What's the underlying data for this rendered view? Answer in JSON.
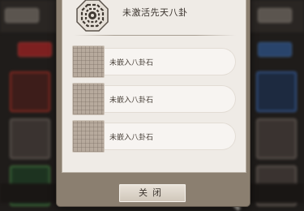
{
  "dialog": {
    "title": "未激活先天八卦",
    "emblem_icon": "bagua-octagon-icon",
    "slots": [
      {
        "label": "未嵌入八卦石",
        "icon": "empty-socket-icon"
      },
      {
        "label": "未嵌入八卦石",
        "icon": "empty-socket-icon"
      },
      {
        "label": "未嵌入八卦石",
        "icon": "empty-socket-icon"
      }
    ],
    "close_label": "关闭"
  },
  "colors": {
    "panel": "#efebe6",
    "frame": "#8b7f70",
    "socket": "#b7aa9d"
  }
}
